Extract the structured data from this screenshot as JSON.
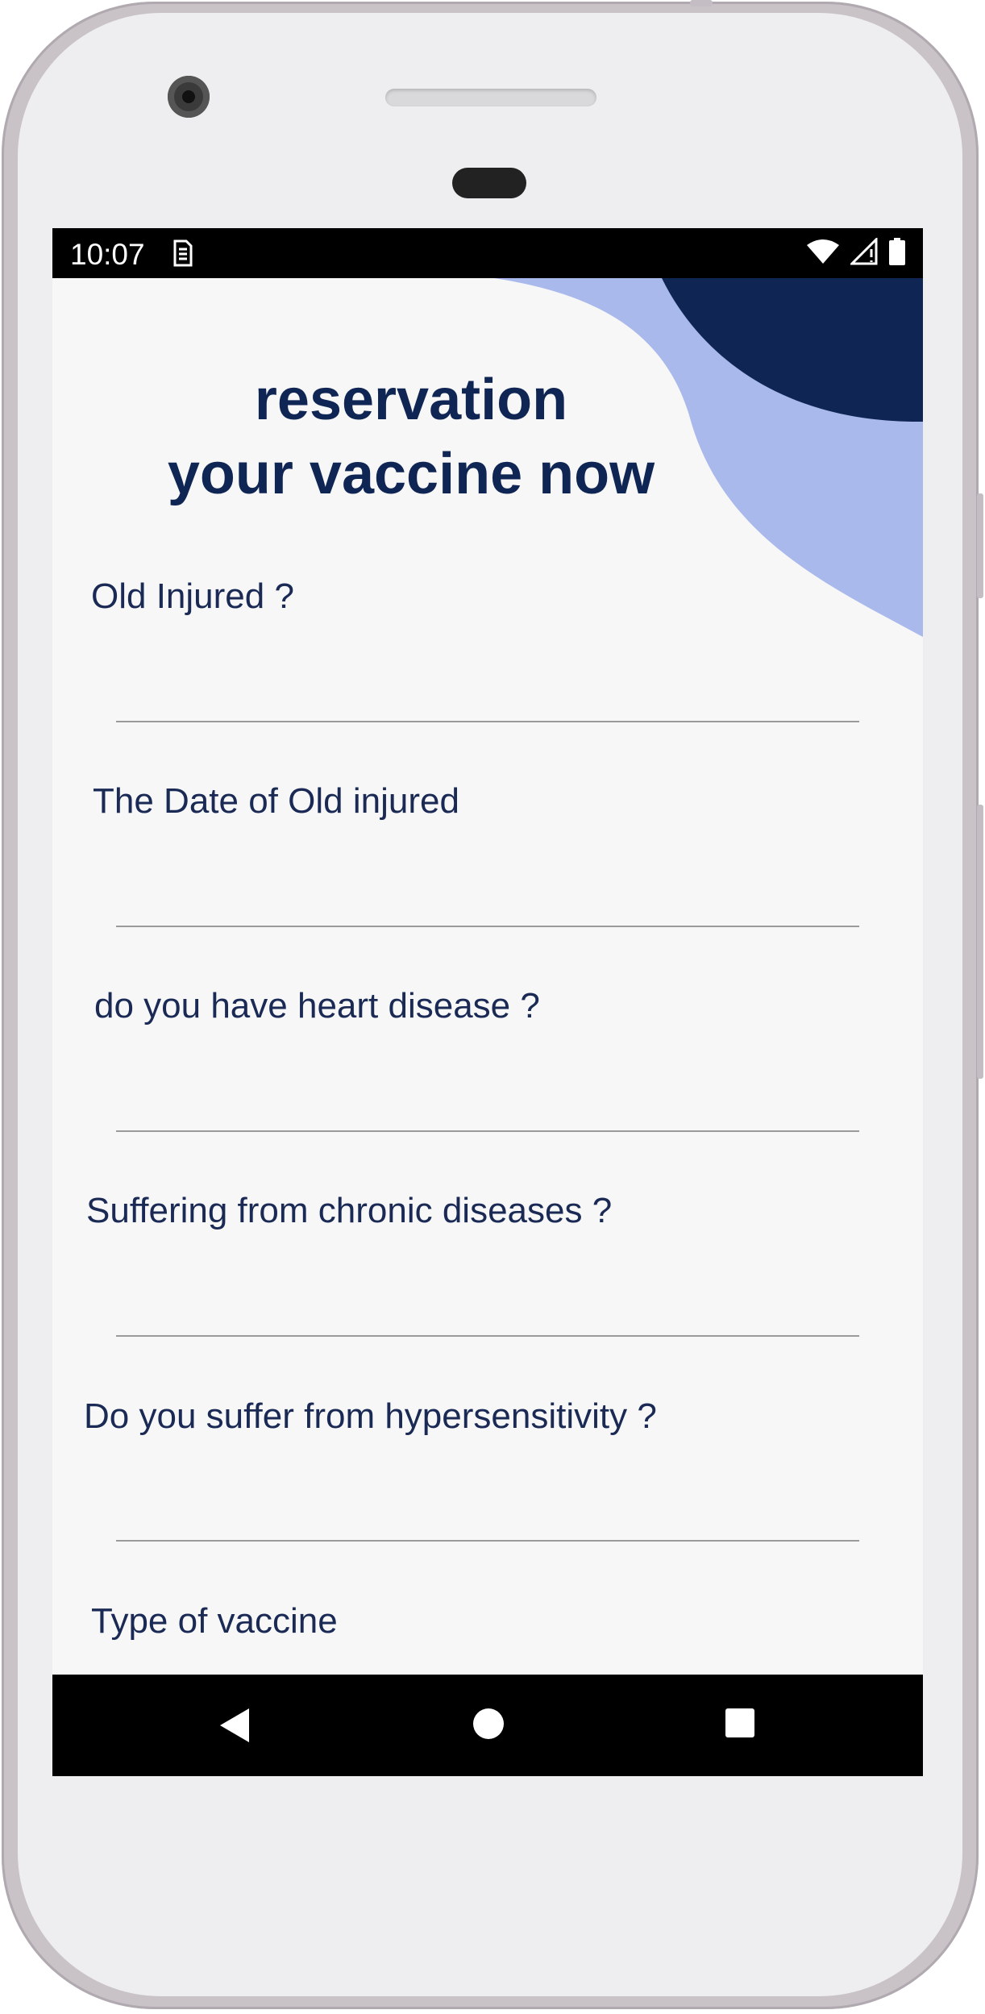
{
  "status_bar": {
    "time": "10:07",
    "sim_icon": "sim-card-icon",
    "wifi_icon": "wifi-icon",
    "signal_icon": "cell-signal-icon",
    "battery_icon": "battery-icon"
  },
  "header": {
    "title_line1": "reservation",
    "title_line2": "your vaccine now"
  },
  "form": {
    "questions": [
      {
        "label": "Old Injured ?",
        "value": ""
      },
      {
        "label": "The Date of Old injured",
        "value": ""
      },
      {
        "label": "do you have heart disease ?",
        "value": ""
      },
      {
        "label": "Suffering from chronic diseases ?",
        "value": ""
      },
      {
        "label": "Do you suffer from hypersensitivity ?",
        "value": ""
      },
      {
        "label": "Type of vaccine",
        "value": ""
      }
    ]
  },
  "nav_bar": {
    "back_icon": "back-triangle-icon",
    "home_icon": "home-circle-icon",
    "recents_icon": "recents-square-icon"
  },
  "colors": {
    "primary_dark": "#0f2553",
    "accent_light": "#aab9ec",
    "background": "#f7f7f8"
  }
}
